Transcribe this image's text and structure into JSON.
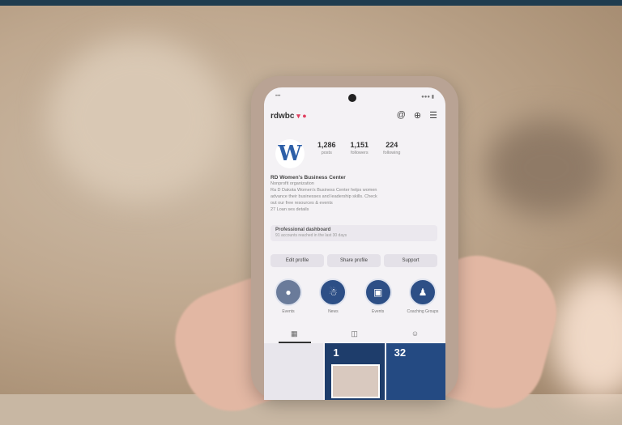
{
  "profile": {
    "handle": "rdwbc",
    "stats": [
      {
        "value": "1,286",
        "label": "posts"
      },
      {
        "value": "1,151",
        "label": "followers"
      },
      {
        "value": "224",
        "label": "following"
      }
    ],
    "name": "RD Women's Business Center",
    "category": "Nonprofit organization",
    "bio_lines": [
      "Ra D Dakota Women's Business Center helps women",
      "advance their businesses and leadership skills. Check",
      "out our free resources & events",
      "27 Loan ses details"
    ],
    "dashboard_title": "Professional dashboard",
    "dashboard_sub": "91 accounts reached in the last 30 days"
  },
  "buttons": [
    "Edit profile",
    "Share profile",
    "Support"
  ],
  "highlights": [
    {
      "label": "Events",
      "icon": "circle-icon"
    },
    {
      "label": "News",
      "icon": "person-icon"
    },
    {
      "label": "Events",
      "icon": "calendar-icon"
    },
    {
      "label": "Coaching Groups",
      "icon": "people-icon"
    }
  ],
  "grid": {
    "cell2_text": "1",
    "cell3_text": "32"
  },
  "colors": {
    "brand": "#2d5fa8",
    "frame": "#1f3c4f"
  }
}
